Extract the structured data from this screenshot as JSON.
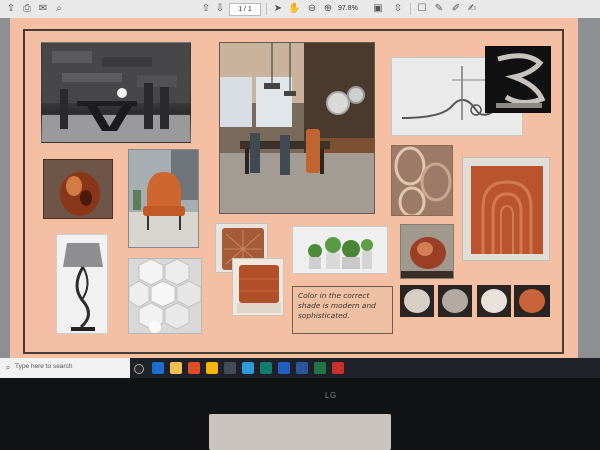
{
  "toolbar": {
    "page_indicator": "1 / 1",
    "zoom": "97.8%",
    "icons": [
      "upload-icon",
      "print-icon",
      "mail-icon",
      "search-icon",
      "help-icon",
      "up-arrow-icon",
      "down-arrow-icon",
      "cursor-icon",
      "hand-icon",
      "zoom-out-icon",
      "zoom-in-icon",
      "fit-page-icon",
      "scroll-icon",
      "comment-icon",
      "pen-icon",
      "highlight-icon",
      "sign-icon",
      "more-icon"
    ]
  },
  "moodboard": {
    "caption": "Color in the correct shade is modern and sophisticated.",
    "colors": {
      "page": "#f4bfa2",
      "frame": "#4a3b33",
      "accent_orange": "#c9633a",
      "rust": "#b9512e"
    }
  },
  "taskbar": {
    "search_placeholder": "Type here to search"
  },
  "monitor": {
    "brand": "LG"
  }
}
